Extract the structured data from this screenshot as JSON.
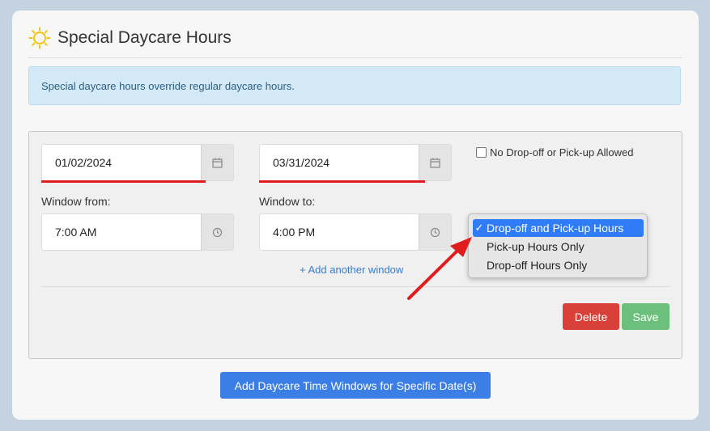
{
  "header": {
    "title": "Special Daycare Hours",
    "icon": "sun-icon"
  },
  "info": {
    "text": "Special daycare hours override regular daycare hours."
  },
  "form": {
    "start_date": "01/02/2024",
    "end_date": "03/31/2024",
    "window_from_label": "Window from:",
    "window_from_value": "7:00 AM",
    "window_to_label": "Window to:",
    "window_to_value": "4:00 PM",
    "no_dropoff_label": "No Drop-off or Pick-up Allowed",
    "no_dropoff_checked": false,
    "add_window_label": "+ Add another window",
    "hours_type": {
      "options": [
        "Drop-off and Pick-up Hours",
        "Pick-up Hours Only",
        "Drop-off Hours Only"
      ],
      "selected": "Drop-off and Pick-up Hours"
    }
  },
  "actions": {
    "delete_label": "Delete",
    "save_label": "Save",
    "add_specific_label": "Add Daycare Time Windows for Specific Date(s)"
  },
  "colors": {
    "accent": "#3a7ee6",
    "delete": "#d9403a",
    "save": "#6cc07c",
    "annotation": "#e01c1c",
    "info_bg": "#d3e9f6"
  }
}
